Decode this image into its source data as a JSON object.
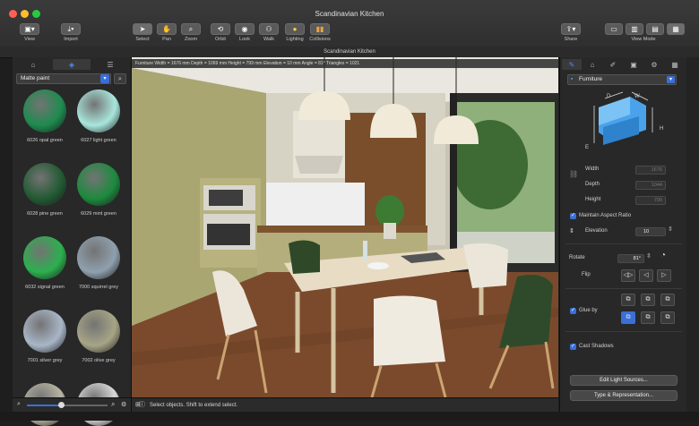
{
  "window": {
    "title": "Scandinavian Kitchen",
    "subtitle": "Scandinavian Kitchen"
  },
  "toolbar": {
    "view": "View",
    "import": "Import",
    "select": "Select",
    "pan": "Pan",
    "zoom": "Zoom",
    "orbit": "Orbit",
    "look": "Look",
    "walk": "Walk",
    "lighting": "Lighting",
    "collisions": "Collisions",
    "share": "Share",
    "view_mode": "View Mode"
  },
  "left_panel": {
    "material_category": "Matte paint",
    "swatches": [
      {
        "label": "6026 opal green",
        "color": "#1e8b4f"
      },
      {
        "label": "6027 light green",
        "color": "#a8e6dc"
      },
      {
        "label": "6028 pine green",
        "color": "#235a34"
      },
      {
        "label": "6029 mint green",
        "color": "#1c8a3e"
      },
      {
        "label": "6032 signal green",
        "color": "#2bb04e"
      },
      {
        "label": "7000 squirrel grey",
        "color": "#8fa0ae"
      },
      {
        "label": "7001 silver grey",
        "color": "#a8b6c7"
      },
      {
        "label": "7002 olive grey",
        "color": "#a7a586"
      },
      {
        "label": "",
        "color": "#b7b4a2"
      },
      {
        "label": "",
        "color": "#d8d8d8"
      }
    ]
  },
  "viewport": {
    "info": "Furniture     Width = 1676 mm   Depth = 1069 mm   Height = 799 mm   Elevation = 10 mm   Angle = 81°   Triangles = 1021",
    "status": "Select objects. Shift to extend select."
  },
  "inspector": {
    "object_type": "Furniture",
    "dims": {
      "d": "D",
      "w": "W",
      "h": "H",
      "e": "E"
    },
    "width_label": "Width",
    "width_value": "1676",
    "depth_label": "Depth",
    "depth_value": "1044",
    "height_label": "Height",
    "height_value": "799",
    "maintain_ratio": "Maintain Aspect Ratio",
    "elevation_label": "Elevation",
    "elevation_value": "10",
    "rotate_label": "Rotate",
    "rotate_value": "81°",
    "flip_label": "Flip",
    "glue_label": "Glue by",
    "cast_shadows": "Cast Shadows",
    "edit_light": "Edit Light Sources...",
    "type_repr": "Type & Representation..."
  },
  "colors": {
    "accent": "#3a6fd8",
    "panel": "#282828",
    "toolbar": "#333333"
  }
}
